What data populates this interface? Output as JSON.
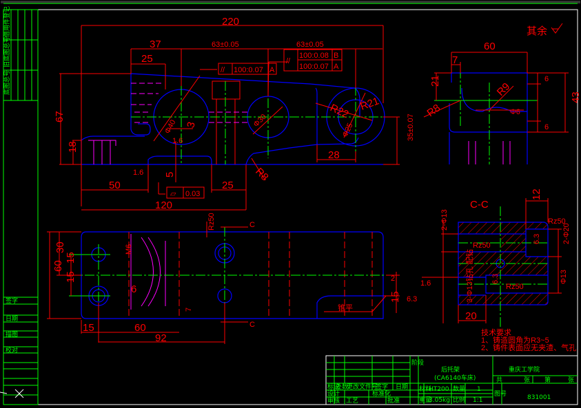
{
  "colors": {
    "background": "#000000",
    "dimension": "#ff0000",
    "outline": "#0000ff",
    "centerline": "#00ff00",
    "hidden": "#ff00ff",
    "frame": "#ffffff",
    "title_block": "#00ff00"
  },
  "front_view": {
    "dims": {
      "overall_length": "220",
      "d37": "37",
      "d25_top": "25",
      "pitch1": "63±0.05",
      "pitch2": "63±0.05",
      "height": "67",
      "base": "18",
      "d50": "50",
      "d25_bottom": "25",
      "d120": "120",
      "d28": "28",
      "d35": "35±0.07",
      "d5": "5",
      "d3": "3",
      "r21": "R21",
      "r22": "R22",
      "r8": "R8",
      "dia40": "Φ40",
      "dia30": "Φ30",
      "dia25": "Φ25"
    },
    "tolerances": [
      {
        "symbol": "//",
        "value": "100:0.07",
        "datum": "A"
      },
      {
        "symbol": "//",
        "value": "100:0.08",
        "datum": "B"
      },
      {
        "symbol": "//",
        "value": "100:0.07",
        "datum": "A"
      },
      {
        "symbol": "▱",
        "value": "0.03",
        "datum": ""
      }
    ],
    "roughness": [
      "1.6",
      "1.6"
    ]
  },
  "side_view": {
    "dims": {
      "d60": "60",
      "d7": "7",
      "r8": "R8",
      "r9": "R9",
      "d6a": "6",
      "d43": "43",
      "d6b": "6",
      "d21": "21",
      "phi6": "Φ6"
    },
    "remainder_note": "其余"
  },
  "top_view": {
    "dims": {
      "d60": "60",
      "d30": "30",
      "d15a": "15",
      "d15b": "15",
      "m6": "M6",
      "d6": "6",
      "d15c": "15",
      "d60b": "60",
      "d92": "92",
      "d7": "7",
      "d2": "2",
      "d15d": "15",
      "rz50": "Rz50",
      "d63": "6.3"
    },
    "section_mark": "C",
    "label": "锥平"
  },
  "section_cc": {
    "title": "C-C",
    "dims": {
      "d12": "12",
      "rz50a": "Rz50",
      "rz50b": "Rz50",
      "rz50c": "Rz50",
      "hole1": "2-Φ13",
      "hole2": "2-Φ20",
      "hole3": "Φ13",
      "d20": "20",
      "r63a": "6.3",
      "r63b": "6.3",
      "r16": "1.6"
    },
    "note": "3-Φ13钻孔 配钻"
  },
  "tech_requirements": {
    "title": "技术要求",
    "items": [
      "1、铸造圆角为R3~5",
      "2、铸件表面应无夹渣、气孔"
    ]
  },
  "title_block": {
    "part_name": "后托架",
    "part_sub": "(CA6140车床)",
    "school": "重庆工学院",
    "material": "HT200",
    "quantity": "1",
    "weight": "3.05kg",
    "scale": "1:1",
    "drawing_no": "831001",
    "labels": {
      "material": "材料",
      "weight": "重量",
      "quantity": "数量",
      "scale": "比例",
      "drawing_no": "图号",
      "mark": "标记",
      "count": "处数",
      "change_doc": "更改文件号",
      "sign": "签字",
      "date": "日期",
      "design": "设计",
      "standard": "标准化",
      "review": "审核",
      "process": "工艺",
      "approve": "批准",
      "stage": "阶段",
      "total": "共",
      "sheet": "张",
      "page": "第"
    }
  },
  "left_strip": {
    "labels": [
      "借用件登记",
      "旧底图总号",
      "底图总号",
      "签字",
      "日期",
      "描图",
      "校对"
    ]
  }
}
